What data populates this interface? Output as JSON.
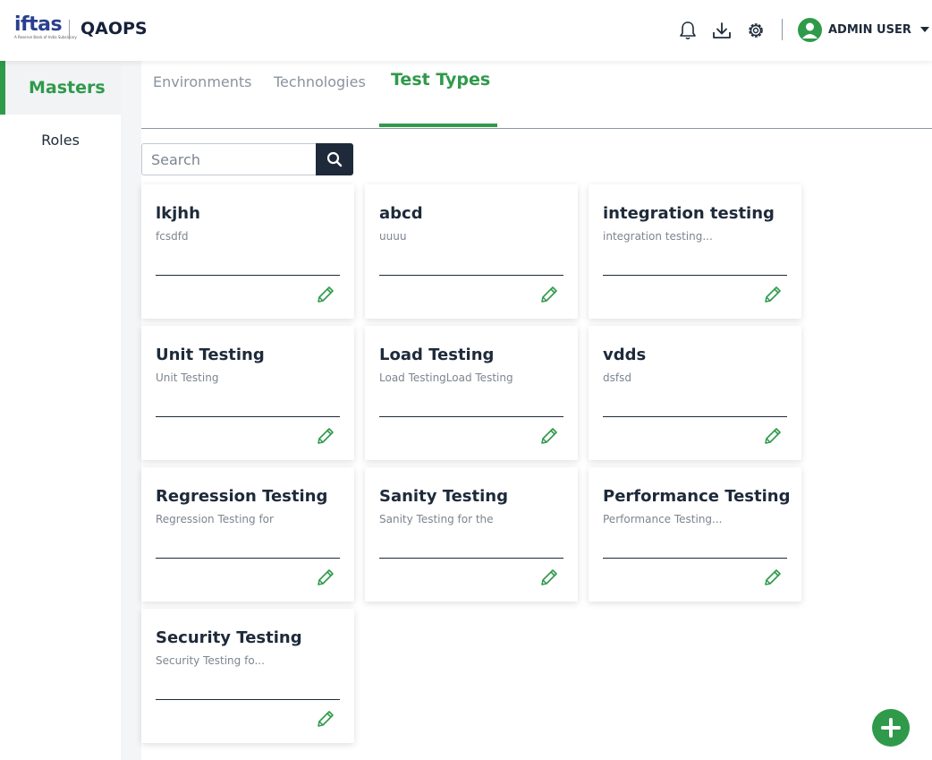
{
  "header": {
    "logo_text": "iftas",
    "logo_subtext": "A Reserve Bank of India Subsidiary",
    "app_title": "QAOPS",
    "icons": [
      "bell-icon",
      "download-icon",
      "settings-icon"
    ],
    "user_name": "ADMIN USER"
  },
  "sidebar": {
    "items": [
      {
        "label": "Masters",
        "active": true
      },
      {
        "label": "Roles",
        "active": false
      }
    ]
  },
  "tabs": [
    {
      "label": "Environments",
      "active": false
    },
    {
      "label": "Technologies",
      "active": false
    },
    {
      "label": "Test Types",
      "active": true
    }
  ],
  "search": {
    "placeholder": "Search",
    "value": ""
  },
  "cards": [
    {
      "title": "lkjhh",
      "description": "fcsdfd"
    },
    {
      "title": "abcd",
      "description": "uuuu"
    },
    {
      "title": "integration testing",
      "description": "integration testing..."
    },
    {
      "title": "Unit Testing",
      "description": "Unit Testing"
    },
    {
      "title": "Load Testing",
      "description": "Load TestingLoad Testing"
    },
    {
      "title": "vdds",
      "description": "dsfsd"
    },
    {
      "title": "Regression Testing",
      "description": "Regression Testing for"
    },
    {
      "title": "Sanity Testing",
      "description": "Sanity Testing for the"
    },
    {
      "title": "Performance Testing",
      "description": "Performance Testing..."
    },
    {
      "title": "Security Testing",
      "description": "Security Testing fo..."
    }
  ],
  "colors": {
    "accent": "#2f9a4a",
    "dark": "#1e2a3a",
    "muted": "#7c8590"
  }
}
